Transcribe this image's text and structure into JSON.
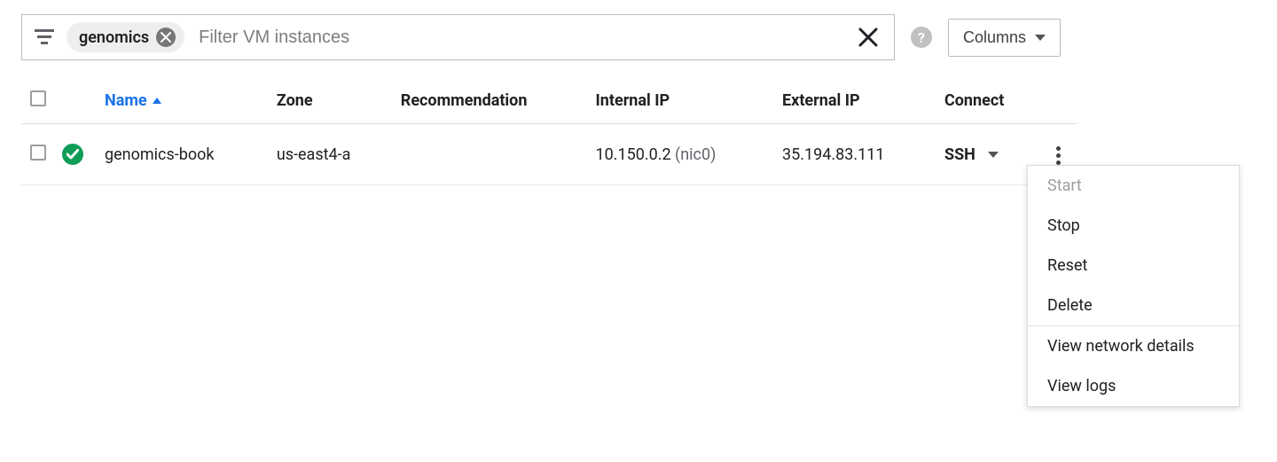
{
  "filter": {
    "chip": "genomics",
    "placeholder": "Filter VM instances"
  },
  "columns_button": "Columns",
  "table": {
    "headers": {
      "name": "Name",
      "zone": "Zone",
      "recommendation": "Recommendation",
      "internal_ip": "Internal IP",
      "external_ip": "External IP",
      "connect": "Connect"
    },
    "rows": [
      {
        "name": "genomics-book",
        "zone": "us-east4-a",
        "recommendation": "",
        "internal_ip": "10.150.0.2",
        "internal_nic": " (nic0)",
        "external_ip": "35.194.83.111",
        "connect": "SSH"
      }
    ]
  },
  "menu": {
    "start": "Start",
    "stop": "Stop",
    "reset": "Reset",
    "delete": "Delete",
    "view_network": "View network details",
    "view_logs": "View logs"
  }
}
